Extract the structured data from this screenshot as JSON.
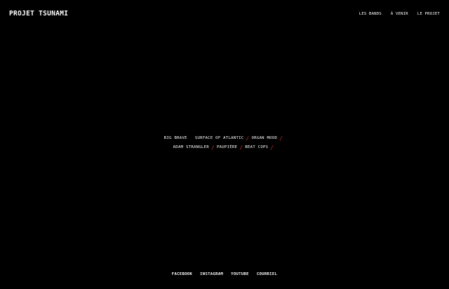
{
  "header": {
    "brand": "PROJET TSUNAMI",
    "nav": [
      "LES BANDS",
      "À VENIR",
      "LE PROJET"
    ]
  },
  "bands": {
    "row1": [
      "BIG BRAVE",
      "SURFACE OF ATLANTIC",
      "ORGAN MOOD"
    ],
    "row2": [
      "ADAM STRANGLER",
      "PAUPIÈRE",
      "BEAT COPS"
    ]
  },
  "footer": {
    "links": [
      "FACEBOOK",
      "INSTAGRAM",
      "YOUTUBE",
      "COURRIEL"
    ]
  },
  "colors": {
    "background": "#000000",
    "text": "#ffffff",
    "separator": "#c92a2a"
  }
}
